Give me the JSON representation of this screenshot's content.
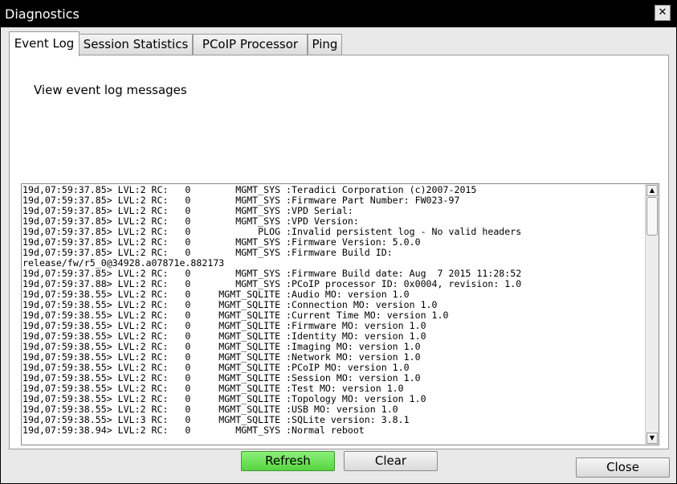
{
  "window": {
    "title": "Diagnostics",
    "close_glyph": "✕"
  },
  "tabs": [
    {
      "label": "Event Log",
      "active": true
    },
    {
      "label": "Session Statistics",
      "active": false
    },
    {
      "label": "PCoIP Processor",
      "active": false
    },
    {
      "label": "Ping",
      "active": false
    }
  ],
  "event_log": {
    "heading": "View event log messages",
    "lines": [
      "19d,07:59:37.85> LVL:2 RC:   0        MGMT_SYS :Teradici Corporation (c)2007-2015",
      "19d,07:59:37.85> LVL:2 RC:   0        MGMT_SYS :Firmware Part Number: FW023-97",
      "19d,07:59:37.85> LVL:2 RC:   0        MGMT_SYS :VPD Serial:",
      "19d,07:59:37.85> LVL:2 RC:   0        MGMT_SYS :VPD Version:",
      "19d,07:59:37.85> LVL:2 RC:   0            PLOG :Invalid persistent log - No valid headers",
      "19d,07:59:37.85> LVL:2 RC:   0        MGMT_SYS :Firmware Version: 5.0.0",
      "19d,07:59:37.85> LVL:2 RC:   0        MGMT_SYS :Firmware Build ID:",
      "release/fw/r5_0@34928.a07871e.882173",
      "19d,07:59:37.85> LVL:2 RC:   0        MGMT_SYS :Firmware Build date: Aug  7 2015 11:28:52",
      "19d,07:59:37.88> LVL:2 RC:   0        MGMT_SYS :PCoIP processor ID: 0x0004, revision: 1.0",
      "19d,07:59:38.55> LVL:2 RC:   0     MGMT_SQLITE :Audio MO: version 1.0",
      "19d,07:59:38.55> LVL:2 RC:   0     MGMT_SQLITE :Connection MO: version 1.0",
      "19d,07:59:38.55> LVL:2 RC:   0     MGMT_SQLITE :Current Time MO: version 1.0",
      "19d,07:59:38.55> LVL:2 RC:   0     MGMT_SQLITE :Firmware MO: version 1.0",
      "19d,07:59:38.55> LVL:2 RC:   0     MGMT_SQLITE :Identity MO: version 1.0",
      "19d,07:59:38.55> LVL:2 RC:   0     MGMT_SQLITE :Imaging MO: version 1.0",
      "19d,07:59:38.55> LVL:2 RC:   0     MGMT_SQLITE :Network MO: version 1.0",
      "19d,07:59:38.55> LVL:2 RC:   0     MGMT_SQLITE :PCoIP MO: version 1.0",
      "19d,07:59:38.55> LVL:2 RC:   0     MGMT_SQLITE :Session MO: version 1.0",
      "19d,07:59:38.55> LVL:2 RC:   0     MGMT_SQLITE :Test MO: version 1.0",
      "19d,07:59:38.55> LVL:2 RC:   0     MGMT_SQLITE :Topology MO: version 1.0",
      "19d,07:59:38.55> LVL:2 RC:   0     MGMT_SQLITE :USB MO: version 1.0",
      "19d,07:59:38.55> LVL:3 RC:   0     MGMT_SQLITE :SQLite version: 3.8.1",
      "19d,07:59:38.94> LVL:2 RC:   0        MGMT_SYS :Normal reboot"
    ],
    "scroll_up_glyph": "▲",
    "scroll_down_glyph": "▼"
  },
  "buttons": {
    "refresh": "Refresh",
    "clear": "Clear",
    "close": "Close"
  },
  "colors": {
    "refresh_accent": "#5ad444",
    "titlebar": "#000000",
    "dialog_background": "#e9e9e9"
  }
}
